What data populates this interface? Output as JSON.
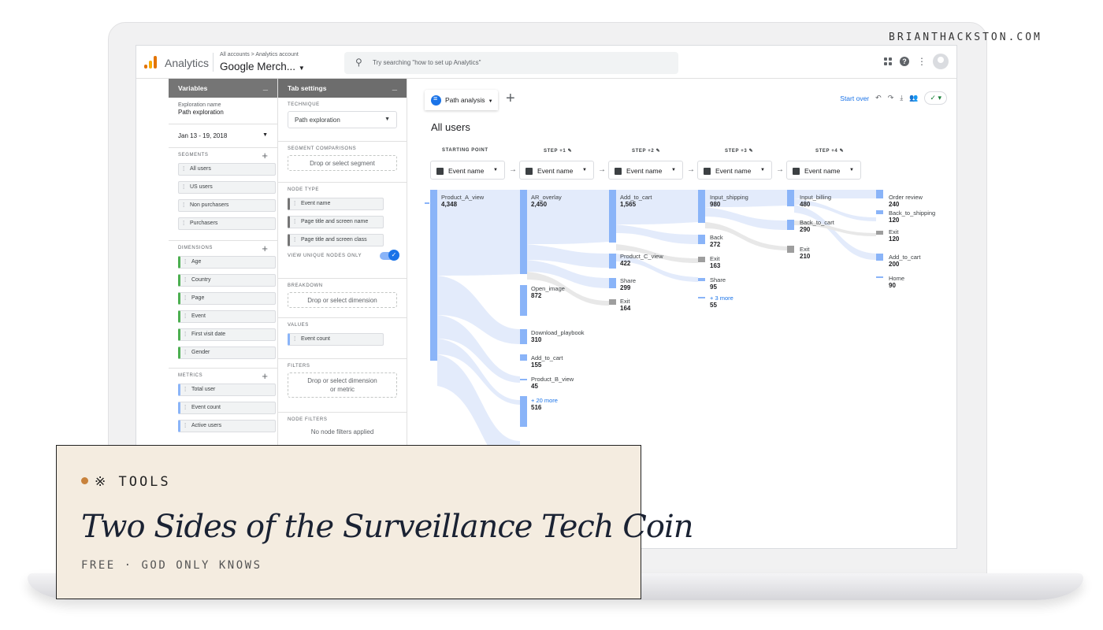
{
  "site_brand": "BRIANTHACKSTON.COM",
  "app": {
    "name": "Analytics",
    "breadcrumb": "All accounts > Analytics account",
    "account": "Google Merch...",
    "search_placeholder": "Try searching \"how to set up Analytics\""
  },
  "variables": {
    "header": "Variables",
    "exploration_label": "Exploration name",
    "exploration_name": "Path exploration",
    "date_range": "Jan 13 - 19, 2018",
    "segments_label": "SEGMENTS",
    "segments": [
      "All users",
      "US users",
      "Non purchasers",
      "Purchasers"
    ],
    "dimensions_label": "DIMENSIONS",
    "dimensions": [
      "Age",
      "Country",
      "Page",
      "Event",
      "First visit date",
      "Gender"
    ],
    "metrics_label": "METRICS",
    "metrics": [
      "Total user",
      "Event count",
      "Active users"
    ]
  },
  "tab_settings": {
    "header": "Tab settings",
    "technique_label": "TECHNIQUE",
    "technique": "Path exploration",
    "segment_comparisons_label": "SEGMENT COMPARISONS",
    "segment_drop": "Drop or select segment",
    "node_type_label": "NODE TYPE",
    "node_types": [
      "Event name",
      "Page title and screen name",
      "Page title and screen class"
    ],
    "unique_nodes": "VIEW UNIQUE NODES ONLY",
    "unique_nodes_on": true,
    "breakdown_label": "BREAKDOWN",
    "breakdown_drop": "Drop or select dimension",
    "values_label": "VALUES",
    "value": "Event count",
    "filters_label": "FILTERS",
    "filters_drop_1": "Drop or select dimension",
    "filters_drop_2": "or metric",
    "node_filters_label": "NODE FILTERS",
    "node_filters": "No node filters applied"
  },
  "canvas": {
    "tab_label": "Path analysis",
    "start_over": "Start over",
    "segment_title": "All users",
    "steps": [
      {
        "label": "STARTING POINT",
        "dropdown": "Event name"
      },
      {
        "label": "STEP +1",
        "dropdown": "Event name"
      },
      {
        "label": "STEP +2",
        "dropdown": "Event name"
      },
      {
        "label": "STEP +3",
        "dropdown": "Event name"
      },
      {
        "label": "STEP +4",
        "dropdown": "Event name"
      }
    ]
  },
  "path_nodes": {
    "start": [
      {
        "name": "Product_A_view",
        "value": "4,348"
      }
    ],
    "step1": [
      {
        "name": "AR_overlay",
        "value": "2,450"
      },
      {
        "name": "Open_image",
        "value": "872"
      },
      {
        "name": "Download_playbook",
        "value": "310"
      },
      {
        "name": "Add_to_cart",
        "value": "155"
      },
      {
        "name": "Product_B_view",
        "value": "45"
      },
      {
        "name": "+ 20 more",
        "value": "516"
      }
    ],
    "step2": [
      {
        "name": "Add_to_cart",
        "value": "1,565"
      },
      {
        "name": "Product_C_view",
        "value": "422"
      },
      {
        "name": "Share",
        "value": "299"
      },
      {
        "name": "Exit",
        "value": "164"
      }
    ],
    "step3": [
      {
        "name": "Input_shipping",
        "value": "980"
      },
      {
        "name": "Back",
        "value": "272"
      },
      {
        "name": "Exit",
        "value": "163"
      },
      {
        "name": "Share",
        "value": "95"
      },
      {
        "name": "+ 3 more",
        "value": "55"
      }
    ],
    "step4": [
      {
        "name": "Input_billing",
        "value": "480"
      },
      {
        "name": "Back_to_cart",
        "value": "290"
      },
      {
        "name": "Exit",
        "value": "210"
      }
    ],
    "step5": [
      {
        "name": "Order review",
        "value": "240"
      },
      {
        "name": "Back_to_shipping",
        "value": "120"
      },
      {
        "name": "Exit",
        "value": "120"
      },
      {
        "name": "Add_to_cart",
        "value": "200"
      },
      {
        "name": "Home",
        "value": "90"
      }
    ]
  },
  "card": {
    "tag": "※ TOOLS",
    "title": "Two Sides of the Surveillance Tech Coin",
    "subtitle": "FREE · GOD ONLY KNOWS"
  },
  "colors": {
    "node_blue": "#8ab4f8",
    "flow_blue": "#e1eafc",
    "exit_gray": "#9e9e9e",
    "accent": "#1a73e8",
    "card_bg": "#f4ece0",
    "card_dot": "#c8823c"
  }
}
